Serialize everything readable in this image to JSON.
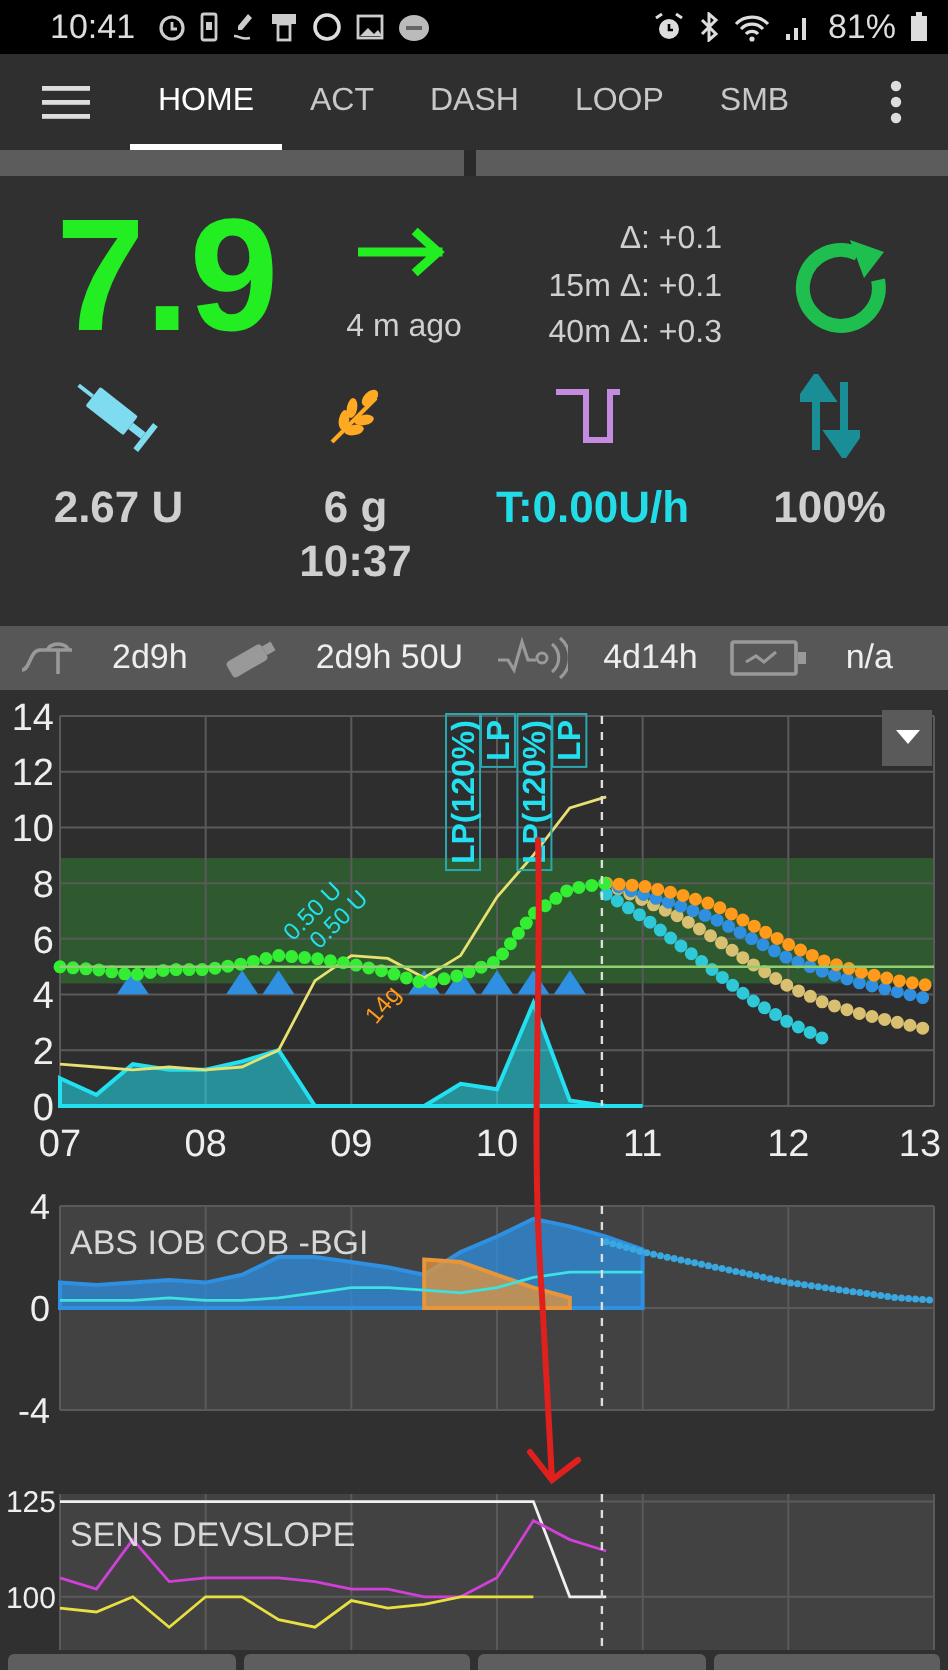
{
  "status_bar": {
    "time": "10:41",
    "battery": "81%"
  },
  "toolbar": {
    "tabs": [
      {
        "label": "HOME",
        "selected": true
      },
      {
        "label": "ACT",
        "selected": false
      },
      {
        "label": "DASH",
        "selected": false
      },
      {
        "label": "LOOP",
        "selected": false
      },
      {
        "label": "SMB",
        "selected": false
      }
    ]
  },
  "overview": {
    "bg": "7.9",
    "age": "4 m ago",
    "deltas": [
      "Δ: +0.1",
      "15m Δ: +0.1",
      "40m Δ: +0.3"
    ]
  },
  "stats": [
    {
      "kind": "insulin",
      "color": "#cfcfcf",
      "lines": [
        "2.67 U"
      ]
    },
    {
      "kind": "carbs",
      "color": "#cfcfcf",
      "lines": [
        "6 g",
        "10:37"
      ]
    },
    {
      "kind": "basal",
      "color": "#22dde8",
      "lines": [
        "T:0.00U/h"
      ]
    },
    {
      "kind": "profile",
      "color": "#cfcfcf",
      "lines": [
        "100%"
      ]
    }
  ],
  "device_status": [
    {
      "kind": "cannula",
      "text": "2d9h"
    },
    {
      "kind": "reservoir",
      "text": "2d9h 50U"
    },
    {
      "kind": "sensor",
      "text": "4d14h"
    },
    {
      "kind": "battery",
      "text": "n/a"
    }
  ],
  "bg_chart": {
    "chart_data": {
      "type": "line",
      "grid": true,
      "xlim": [
        7,
        13
      ],
      "ylim": [
        0,
        14
      ],
      "xticks": [
        {
          "value": 7,
          "label": "07"
        },
        {
          "value": 8,
          "label": "08"
        },
        {
          "value": 9,
          "label": "09"
        },
        {
          "value": 10,
          "label": "10"
        },
        {
          "value": 11,
          "label": "11"
        },
        {
          "value": 12,
          "label": "12"
        },
        {
          "value": 13,
          "label": "13"
        }
      ],
      "yticks": [
        0,
        2,
        4,
        6,
        8,
        10,
        12,
        14
      ],
      "x": [
        7,
        7.25,
        7.5,
        7.75,
        8,
        8.25,
        8.5,
        8.75,
        9,
        9.25,
        9.5,
        9.75,
        10,
        10.25,
        10.5,
        10.75,
        11,
        11.25,
        11.5,
        11.75,
        12,
        12.25,
        12.5,
        12.75,
        13
      ],
      "bands": [
        {
          "axis": "y",
          "from": 4.4,
          "to": 8.9,
          "color": "#2f5a2f"
        }
      ],
      "ref_lines": [
        {
          "axis": "y",
          "value": 5.0,
          "color": "#8fcf6f"
        },
        {
          "axis": "x",
          "value": 10.72,
          "color": "#dddddd",
          "line_style": "dashed"
        }
      ],
      "series": [
        {
          "type": "area",
          "color": "#22e0f0",
          "values": [
            1.0,
            0.4,
            1.5,
            1.3,
            1.3,
            1.6,
            2.0,
            0,
            0,
            0,
            0,
            0.8,
            0.6,
            3.7,
            0.2,
            0,
            0,
            null,
            null,
            null,
            null,
            null,
            null,
            null,
            null
          ]
        },
        {
          "type": "scatter",
          "marker": "triangle",
          "color": "#2f8fe0",
          "values": [
            null,
            null,
            4.3,
            null,
            null,
            4.3,
            4.3,
            null,
            null,
            null,
            4.3,
            4.3,
            4.3,
            4.3,
            4.3,
            null,
            null,
            null,
            null,
            null,
            null,
            null,
            null,
            null,
            null
          ]
        },
        {
          "type": "line",
          "color": "#e8e070",
          "values": [
            1.5,
            1.4,
            1.3,
            1.4,
            1.3,
            1.4,
            2.0,
            4.5,
            5.4,
            5.3,
            4.6,
            5.4,
            7.5,
            9.0,
            10.7,
            11.1,
            null,
            null,
            null,
            null,
            null,
            null,
            null,
            null,
            null
          ]
        },
        {
          "type": "line",
          "line_style": "dotted",
          "color": "#d8c070",
          "values": [
            null,
            null,
            null,
            null,
            null,
            null,
            null,
            null,
            null,
            null,
            null,
            null,
            null,
            null,
            null,
            8.0,
            7.4,
            6.8,
            6.0,
            5.1,
            4.3,
            3.7,
            3.3,
            3.0,
            2.7
          ]
        },
        {
          "type": "line",
          "line_style": "dotted",
          "color": "#2f8fe0",
          "values": [
            null,
            null,
            null,
            null,
            null,
            null,
            null,
            null,
            null,
            null,
            null,
            null,
            null,
            null,
            null,
            8.0,
            7.6,
            7.2,
            6.7,
            6.0,
            5.3,
            4.8,
            4.4,
            4.1,
            3.8
          ]
        },
        {
          "type": "line",
          "line_style": "dotted",
          "color": "#ff9a1a",
          "values": [
            null,
            null,
            null,
            null,
            null,
            null,
            null,
            null,
            null,
            null,
            null,
            null,
            null,
            null,
            null,
            8.0,
            7.9,
            7.6,
            7.2,
            6.5,
            5.8,
            5.2,
            4.8,
            4.5,
            4.3
          ]
        },
        {
          "type": "line",
          "line_style": "dotted",
          "color": "#2ec8d8",
          "values": [
            null,
            null,
            null,
            null,
            null,
            null,
            null,
            null,
            null,
            null,
            null,
            null,
            null,
            null,
            null,
            7.6,
            6.8,
            5.8,
            4.8,
            3.8,
            3.0,
            2.4,
            null,
            null,
            null
          ]
        },
        {
          "type": "line",
          "line_style": "dotted",
          "color": "#33ee33",
          "values": [
            5.0,
            4.9,
            4.7,
            4.9,
            4.9,
            5.1,
            5.4,
            5.3,
            5.1,
            4.8,
            4.4,
            4.7,
            5.2,
            6.9,
            7.8,
            8.0,
            null,
            null,
            null,
            null,
            null,
            null,
            null,
            null,
            null
          ]
        }
      ],
      "annotations": [
        "LP(120%)",
        "LP",
        "LP(120%)",
        "LP",
        "0.50 U",
        "0.50 U",
        "14g"
      ]
    }
  },
  "iob_chart": {
    "chart_data": {
      "type": "area",
      "grid": true,
      "title": "ABS IOB COB -BGI",
      "xlim": [
        7,
        13
      ],
      "ylim": [
        -4,
        4
      ],
      "yticks": [
        4,
        0,
        -4
      ],
      "x": [
        7,
        7.25,
        7.5,
        7.75,
        8,
        8.25,
        8.5,
        8.75,
        9,
        9.25,
        9.5,
        9.75,
        10,
        10.25,
        10.5,
        10.75,
        11,
        11.25,
        11.5,
        11.75,
        12,
        12.25,
        12.5,
        12.75,
        13
      ],
      "ref_lines": [
        {
          "axis": "x",
          "value": 10.72,
          "color": "#dddddd",
          "line_style": "dashed"
        }
      ],
      "series": [
        {
          "type": "area",
          "color": "#2f8fe0",
          "values": [
            1.0,
            0.9,
            1.0,
            1.1,
            1.0,
            1.3,
            2.0,
            2.0,
            1.8,
            1.6,
            1.3,
            2.2,
            2.8,
            3.5,
            3.2,
            2.8,
            2.3,
            null,
            null,
            null,
            null,
            null,
            null,
            null,
            null
          ]
        },
        {
          "type": "area",
          "color": "#e8963a",
          "values": [
            null,
            null,
            null,
            null,
            null,
            null,
            null,
            null,
            null,
            null,
            1.9,
            1.8,
            1.3,
            0.8,
            0.4,
            null,
            null,
            null,
            null,
            null,
            null,
            null,
            null,
            null,
            null
          ]
        },
        {
          "type": "line",
          "color": "#3ee0e0",
          "values": [
            0.3,
            0.3,
            0.3,
            0.4,
            0.3,
            0.3,
            0.4,
            0.6,
            0.8,
            0.8,
            0.7,
            0.6,
            0.8,
            1.2,
            1.4,
            1.4,
            1.4,
            null,
            null,
            null,
            null,
            null,
            null,
            null,
            null
          ]
        },
        {
          "type": "line",
          "line_style": "dotted",
          "color": "#3aa8e0",
          "values": [
            null,
            null,
            null,
            null,
            null,
            null,
            null,
            null,
            null,
            null,
            null,
            null,
            null,
            null,
            null,
            2.6,
            2.2,
            1.9,
            1.6,
            1.3,
            1.0,
            0.8,
            0.6,
            0.4,
            0.3
          ]
        }
      ]
    }
  },
  "sens_chart": {
    "chart_data": {
      "type": "line",
      "grid": true,
      "title": "SENS DEVSLOPE",
      "xlim": [
        7,
        13
      ],
      "ylim": [
        86,
        127
      ],
      "yticks": [
        125,
        100
      ],
      "x": [
        7,
        7.25,
        7.5,
        7.75,
        8,
        8.25,
        8.5,
        8.75,
        9,
        9.25,
        9.5,
        9.75,
        10,
        10.25,
        10.5,
        10.75
      ],
      "ref_lines": [
        {
          "axis": "x",
          "value": 10.72,
          "color": "#dddddd",
          "line_style": "dashed"
        }
      ],
      "series": [
        {
          "color": "#f0f0f0",
          "values": [
            125,
            125,
            125,
            125,
            125,
            125,
            125,
            125,
            125,
            125,
            125,
            125,
            125,
            125,
            100,
            100
          ]
        },
        {
          "color": "#d040d8",
          "values": [
            105,
            102,
            115,
            104,
            105,
            105,
            105,
            104,
            102,
            102,
            100,
            100,
            105,
            120,
            115,
            112
          ]
        },
        {
          "color": "#e8e040",
          "values": [
            97,
            96,
            100,
            92,
            100,
            100,
            94,
            92,
            99,
            97,
            98,
            100,
            100,
            100,
            null,
            null
          ]
        }
      ]
    }
  },
  "annotation_arrow": {
    "kind": "freehand"
  },
  "action_buttons": [
    {
      "kind": "button"
    },
    {
      "kind": "button"
    },
    {
      "kind": "button"
    },
    {
      "kind": "button"
    }
  ]
}
